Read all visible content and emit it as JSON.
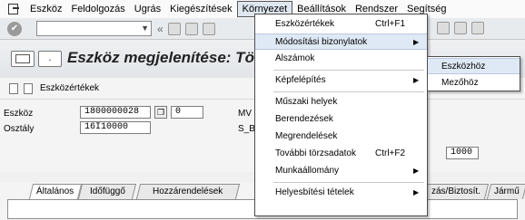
{
  "menubar": {
    "items": [
      "Eszköz",
      "Feldolgozás",
      "Ugrás",
      "Kiegészítések",
      "Környezet",
      "Beállítások",
      "Rendszer",
      "Segítség"
    ],
    "active_index": 4
  },
  "toolbar": {
    "ok_glyph": "✔",
    "command_value": "",
    "back_glyph": "«"
  },
  "title": {
    "text": "Eszköz megjelenítése: Törz",
    "icon2_glyph": "."
  },
  "app_toolbar": {
    "label": "Eszközértékek"
  },
  "form": {
    "eszkoz_label": "Eszköz",
    "eszkoz_value": "1800000028",
    "sub_value": "0",
    "mv_label": "MV",
    "osztaly_label": "Osztály",
    "osztaly_value": "16I10000",
    "sb_label": "S_B",
    "right_value": "1000"
  },
  "tabs": {
    "items": [
      "Általános",
      "Időfüggő",
      "Hozzárendelések",
      "zás/Biztosít.",
      "Jármű"
    ],
    "selected_index": 0
  },
  "dropdown": {
    "items": [
      {
        "label": "Eszközértékek",
        "shortcut": "Ctrl+F1",
        "arrow": ""
      },
      {
        "label": "Módosítási bizonylatok",
        "shortcut": "",
        "arrow": "▶"
      },
      {
        "label": "Alszámok",
        "shortcut": "",
        "arrow": ""
      },
      {
        "label": "Képfelépítés",
        "shortcut": "",
        "arrow": "▶"
      },
      {
        "label": "Műszaki helyek",
        "shortcut": "",
        "arrow": ""
      },
      {
        "label": "Berendezések",
        "shortcut": "",
        "arrow": ""
      },
      {
        "label": "Megrendelések",
        "shortcut": "",
        "arrow": ""
      },
      {
        "label": "További törzsadatok",
        "shortcut": "Ctrl+F2",
        "arrow": ""
      },
      {
        "label": "Munkaállomány",
        "shortcut": "",
        "arrow": "▶"
      },
      {
        "label": "Helyesbítési tételek",
        "shortcut": "",
        "arrow": "▶"
      }
    ],
    "highlighted_index": 1
  },
  "submenu": {
    "items": [
      "Eszközhöz",
      "Mezőhöz"
    ],
    "highlighted_index": 0
  }
}
